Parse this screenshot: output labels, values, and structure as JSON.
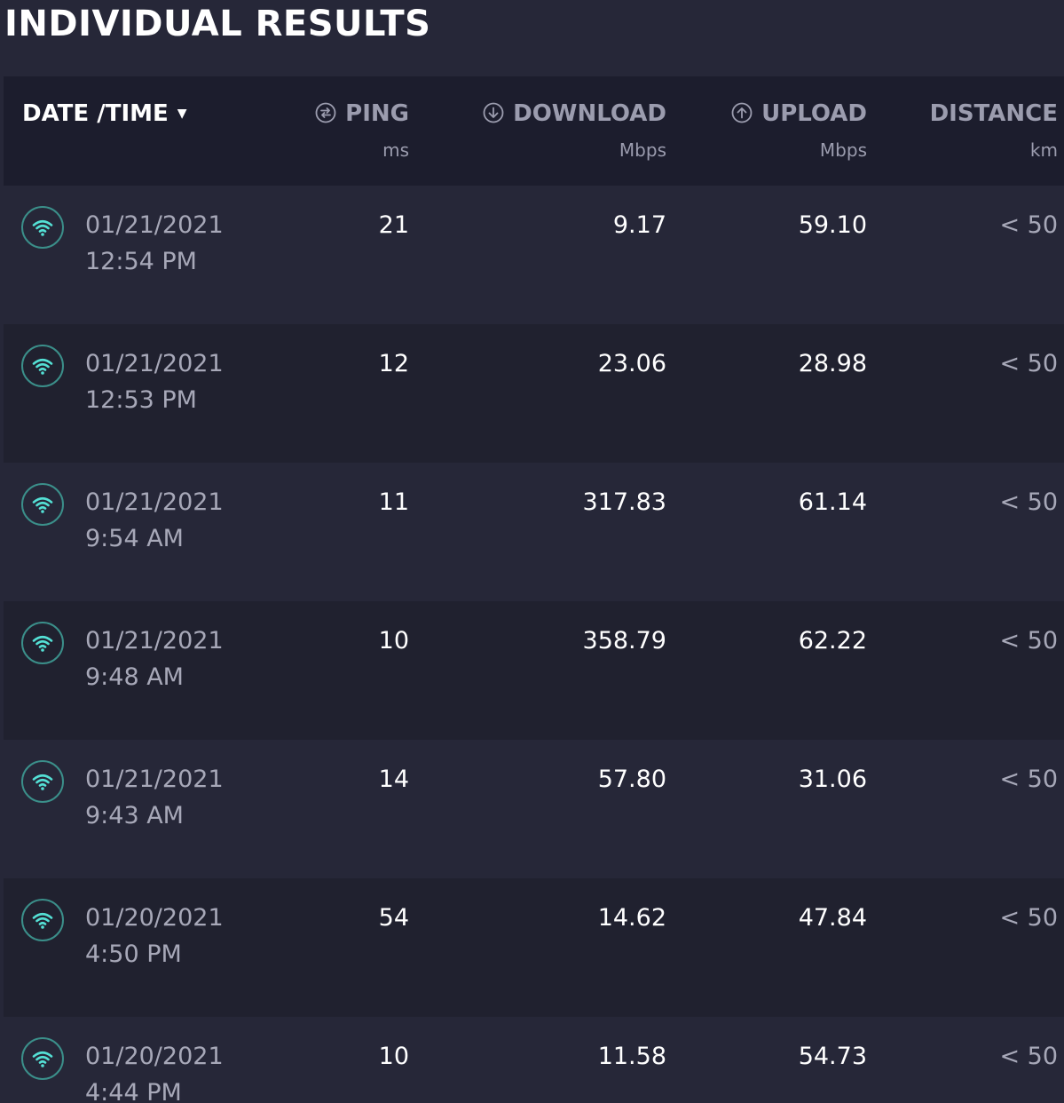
{
  "page": {
    "title": "INDIVIDUAL RESULTS"
  },
  "columns": {
    "date": {
      "label": "DATE /TIME",
      "sort_indicator": "▼"
    },
    "ping": {
      "label": "PING",
      "unit": "ms",
      "icon": "ping-icon"
    },
    "download": {
      "label": "DOWNLOAD",
      "unit": "Mbps",
      "icon": "download-icon"
    },
    "upload": {
      "label": "UPLOAD",
      "unit": "Mbps",
      "icon": "upload-icon"
    },
    "distance": {
      "label": "DISTANCE",
      "unit": "km"
    }
  },
  "colors": {
    "accent": "#54e0d5",
    "background": "#262738",
    "header_background": "#1c1d2d"
  },
  "rows": [
    {
      "icon": "wifi-icon",
      "date": "01/21/2021",
      "time": "12:54 PM",
      "ping": "21",
      "download": "9.17",
      "upload": "59.10",
      "distance": "< 50"
    },
    {
      "icon": "wifi-icon",
      "date": "01/21/2021",
      "time": "12:53 PM",
      "ping": "12",
      "download": "23.06",
      "upload": "28.98",
      "distance": "< 50"
    },
    {
      "icon": "wifi-icon",
      "date": "01/21/2021",
      "time": "9:54 AM",
      "ping": "11",
      "download": "317.83",
      "upload": "61.14",
      "distance": "< 50"
    },
    {
      "icon": "wifi-icon",
      "date": "01/21/2021",
      "time": "9:48 AM",
      "ping": "10",
      "download": "358.79",
      "upload": "62.22",
      "distance": "< 50"
    },
    {
      "icon": "wifi-icon",
      "date": "01/21/2021",
      "time": "9:43 AM",
      "ping": "14",
      "download": "57.80",
      "upload": "31.06",
      "distance": "< 50"
    },
    {
      "icon": "wifi-icon",
      "date": "01/20/2021",
      "time": "4:50 PM",
      "ping": "54",
      "download": "14.62",
      "upload": "47.84",
      "distance": "< 50"
    },
    {
      "icon": "wifi-icon",
      "date": "01/20/2021",
      "time": "4:44 PM",
      "ping": "10",
      "download": "11.58",
      "upload": "54.73",
      "distance": "< 50"
    }
  ]
}
